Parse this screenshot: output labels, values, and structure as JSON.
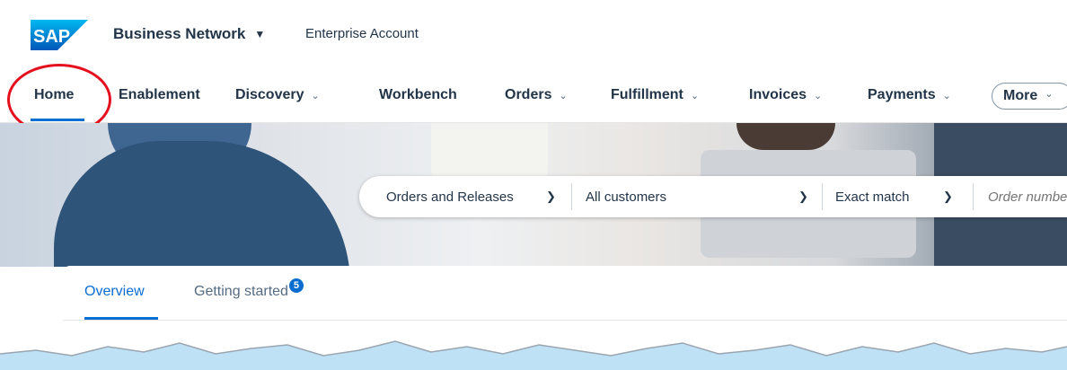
{
  "shell": {
    "logo_text": "SAP",
    "brand": "Business Network",
    "account": "Enterprise Account"
  },
  "nav": {
    "items": [
      {
        "label": "Home",
        "has_dropdown": false
      },
      {
        "label": "Enablement",
        "has_dropdown": false
      },
      {
        "label": "Discovery",
        "has_dropdown": true
      },
      {
        "label": "Workbench",
        "has_dropdown": false
      },
      {
        "label": "Orders",
        "has_dropdown": true
      },
      {
        "label": "Fulfillment",
        "has_dropdown": true
      },
      {
        "label": "Invoices",
        "has_dropdown": true
      },
      {
        "label": "Payments",
        "has_dropdown": true
      }
    ],
    "more_label": "More",
    "active": "Home"
  },
  "search": {
    "document_type": "Orders and Releases",
    "customer": "All customers",
    "match_mode": "Exact match",
    "placeholder": "Order number"
  },
  "tabs": {
    "overview": "Overview",
    "getting_started": "Getting started",
    "getting_started_badge": "5",
    "active": "Overview"
  },
  "colors": {
    "accent": "#0a6ed1",
    "text": "#223548",
    "highlight_circle": "#e4101e",
    "frame_background": "#bfe1f5"
  },
  "icons": {
    "brand_caret": "triangle-down",
    "dropdown": "chevron-down"
  }
}
